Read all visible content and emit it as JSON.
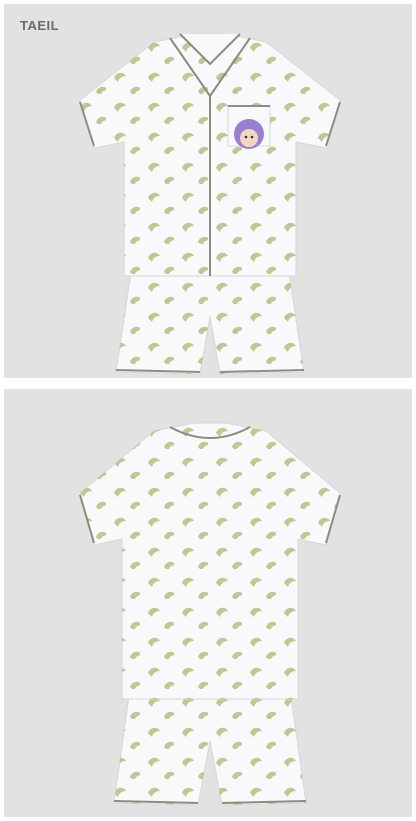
{
  "product": {
    "member_label": "TAEIL",
    "colors": {
      "background": "#e2e2e2",
      "fabric": "#f7f9fa",
      "piping": "#8e8c7e",
      "print": "#b7c484",
      "patch": "#9a7fd0"
    },
    "views": [
      {
        "name": "front"
      },
      {
        "name": "back"
      }
    ]
  }
}
